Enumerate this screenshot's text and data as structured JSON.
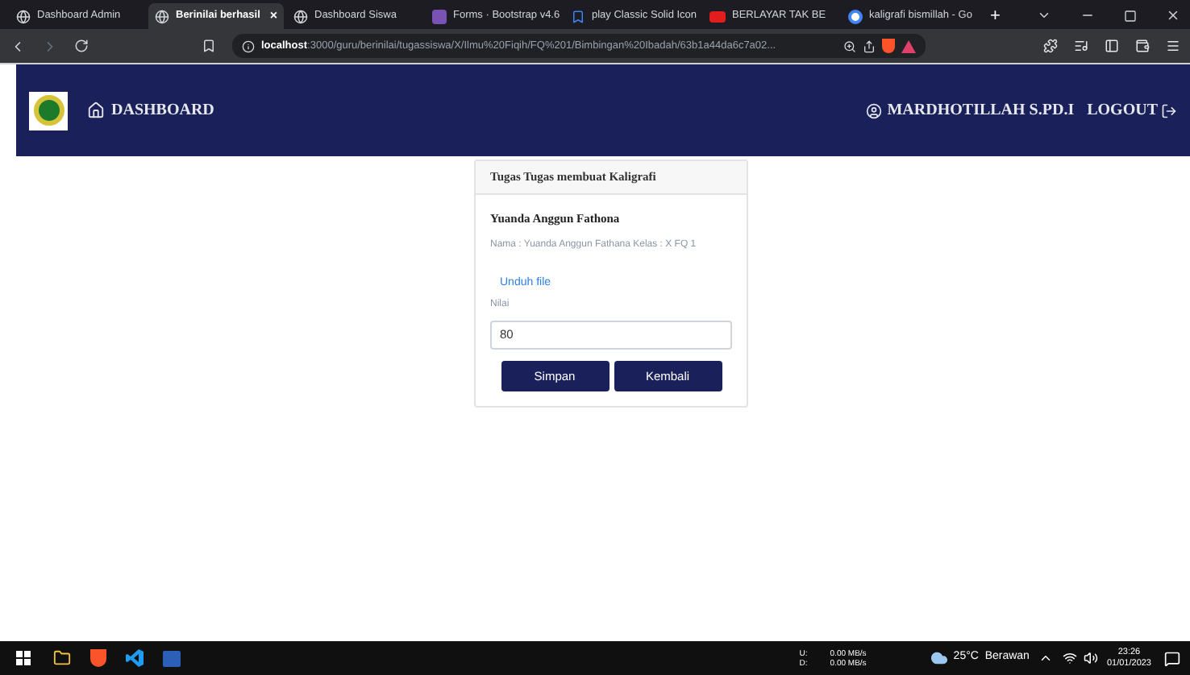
{
  "browser": {
    "tabs": [
      {
        "title": "Dashboard Admin",
        "selected": false
      },
      {
        "title": "Berinilai berhasil",
        "selected": true,
        "close": "×"
      },
      {
        "title": "Dashboard Siswa",
        "selected": false
      },
      {
        "title": "Forms · Bootstrap v4.6",
        "selected": false
      },
      {
        "title": "play Classic Solid Icon",
        "selected": false
      },
      {
        "title": "BERLAYAR TAK BE",
        "selected": false
      },
      {
        "title": "kaligrafi bismillah - Go",
        "selected": false
      }
    ],
    "new_tab": "+",
    "address": {
      "host": "localhost",
      "path": ":3000/guru/berinilai/tugassiswa/X/Ilmu%20Fiqih/FQ%201/Bimbingan%20Ibadah/63b1a44da6c7a02..."
    }
  },
  "navbar": {
    "brand": "DASHBOARD",
    "user": "MARDHOTILLAH S.PD.I",
    "logout": "LOGOUT"
  },
  "card": {
    "title": "Tugas Tugas membuat Kaligrafi",
    "student": "Yuanda Anggun Fathona",
    "info": "Nama : Yuanda Anggun Fathana Kelas : X FQ 1",
    "download_link": "Unduh file",
    "score_label": "Nilai",
    "score_value": "80",
    "buttons": [
      "Simpan",
      "Kembali"
    ]
  },
  "taskbar": {
    "net_labels": [
      "U:",
      "D:"
    ],
    "net_speeds": [
      "0.00 MB/s",
      "0.00 MB/s"
    ],
    "weather": "25°C  Berawan",
    "time": "23:26",
    "date": "01/01/2023"
  }
}
